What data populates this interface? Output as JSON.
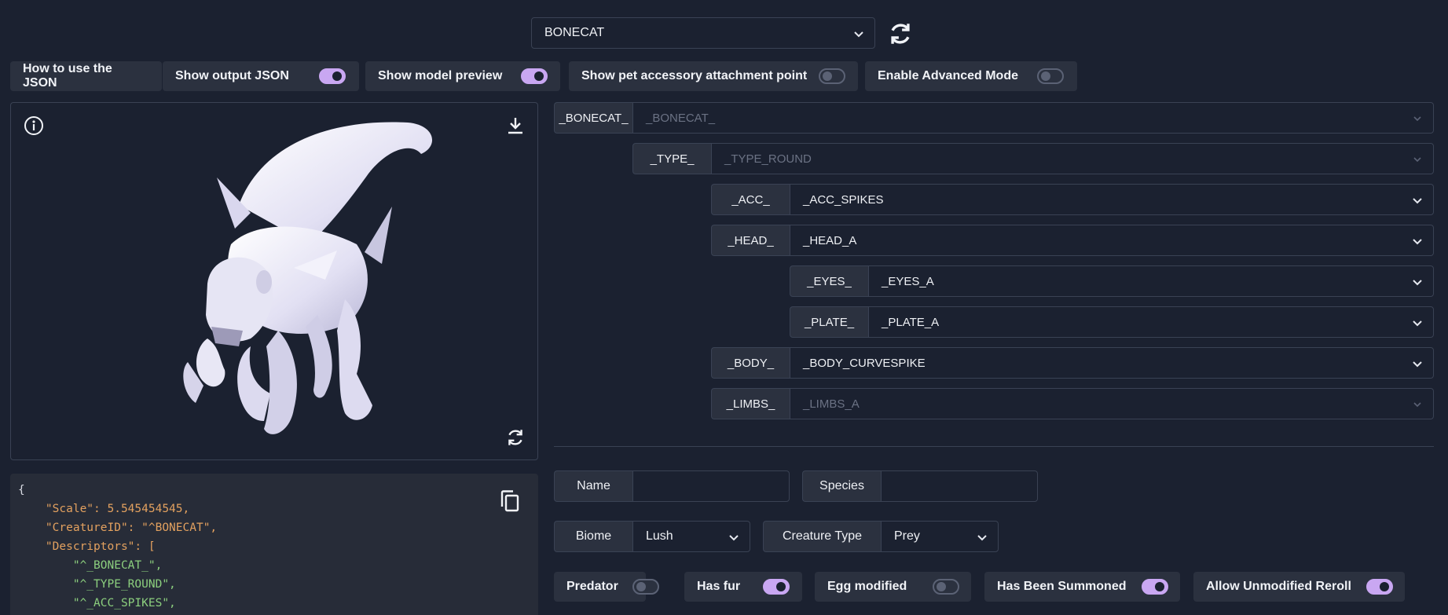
{
  "top_select": {
    "value": "BONECAT"
  },
  "toggles": [
    {
      "label": "How to use the JSON"
    },
    {
      "label": "Show output JSON",
      "on": true
    },
    {
      "label": "Show model preview",
      "on": true
    },
    {
      "label": "Show pet accessory attachment point",
      "on": false
    },
    {
      "label": "Enable Advanced Mode",
      "on": false
    }
  ],
  "json_output": {
    "lines": [
      "{",
      "\"Scale\": 5.545454545,",
      "\"CreatureID\": \"^BONECAT\",",
      "\"Descriptors\": [",
      "\"^_BONECAT_\",",
      "\"^_TYPE_ROUND\",",
      "\"^_ACC_SPIKES\","
    ]
  },
  "descriptors": [
    {
      "label": "_BONECAT_",
      "value": "_BONECAT_",
      "dim": true
    },
    {
      "label": "_TYPE_",
      "value": "_TYPE_ROUND",
      "dim": true
    },
    {
      "label": "_ACC_",
      "value": "_ACC_SPIKES",
      "dim": false
    },
    {
      "label": "_HEAD_",
      "value": "_HEAD_A",
      "dim": false
    },
    {
      "label": "_EYES_",
      "value": "_EYES_A",
      "dim": false
    },
    {
      "label": "_PLATE_",
      "value": "_PLATE_A",
      "dim": false
    },
    {
      "label": "_BODY_",
      "value": "_BODY_CURVESPIKE",
      "dim": false
    },
    {
      "label": "_LIMBS_",
      "value": "_LIMBS_A",
      "dim": true
    }
  ],
  "form": {
    "name_label": "Name",
    "name_value": "",
    "species_label": "Species",
    "species_value": "",
    "biome_label": "Biome",
    "biome_value": "Lush",
    "creature_type_label": "Creature Type",
    "creature_type_value": "Prey"
  },
  "flags": [
    {
      "label": "Predator",
      "on": false
    },
    {
      "label": "Has fur",
      "on": true
    },
    {
      "label": "Egg modified",
      "on": false
    },
    {
      "label": "Has Been Summoned",
      "on": true
    },
    {
      "label": "Allow Unmodified Reroll",
      "on": true
    }
  ],
  "colors": {
    "accent": "#c9a7f2",
    "background": "#1b2130",
    "panel": "#2b313f"
  }
}
